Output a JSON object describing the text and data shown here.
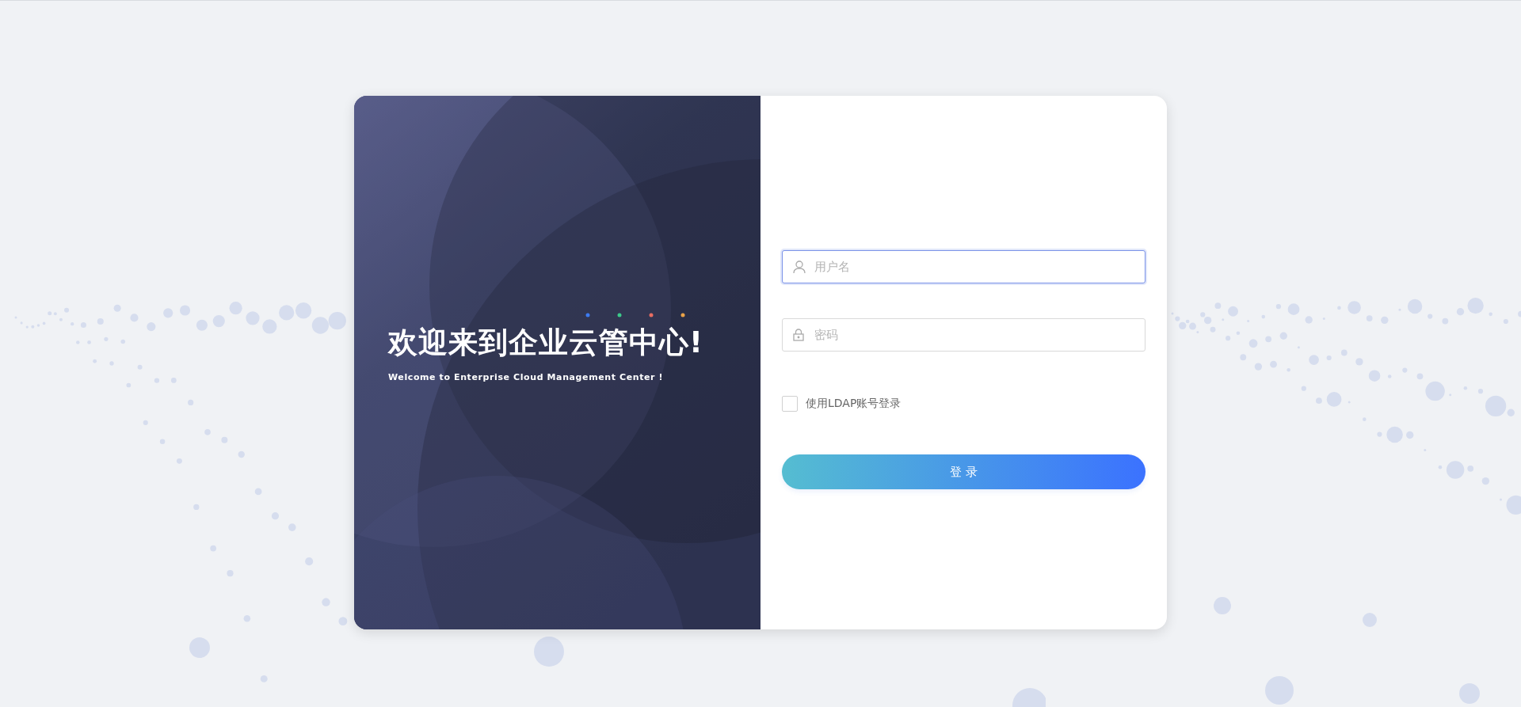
{
  "welcome": {
    "title": "欢迎来到企业云管中心!",
    "subtitle": "Welcome to Enterprise Cloud Management Center !"
  },
  "fields": [
    {
      "kind": "user",
      "placeholder": "用户名",
      "focused": true
    },
    {
      "kind": "password",
      "placeholder": "密码",
      "focused": false
    }
  ],
  "ldap": {
    "label": "使用LDAP账号登录",
    "checked": false
  },
  "login_button": "登 录"
}
